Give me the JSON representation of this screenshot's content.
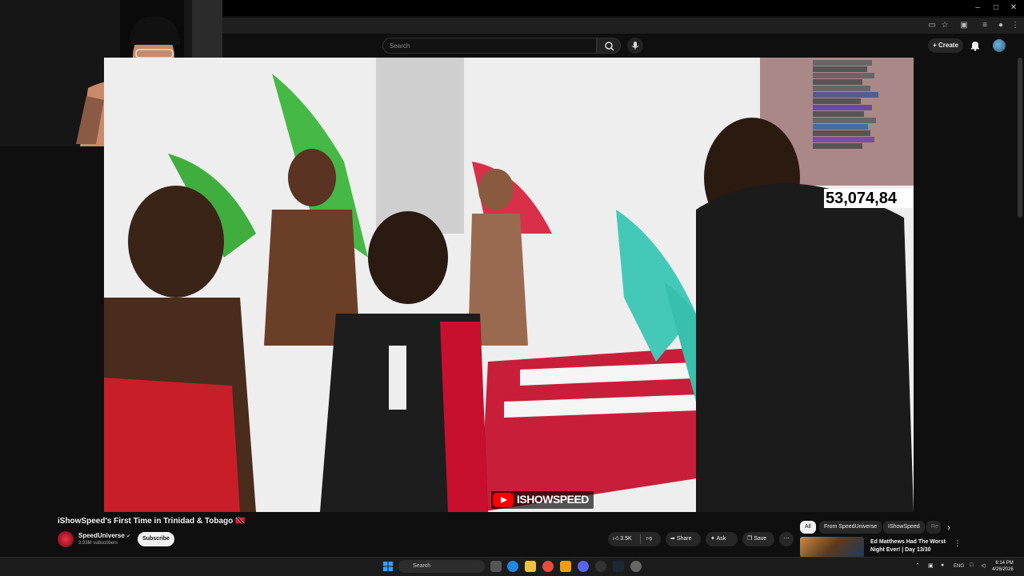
{
  "window": {
    "minimize": "–",
    "maximize": "□",
    "close": "✕"
  },
  "youtube": {
    "search_placeholder": "Search",
    "create_label": "Create",
    "icons": [
      "search-icon",
      "mic-icon",
      "bell-icon",
      "account-avatar"
    ]
  },
  "overlay": {
    "counter": "53,074,84",
    "watermark": "ISHOWSPEED"
  },
  "video": {
    "title": "iShowSpeed's First Time in Trinidad & Tobago 🇹🇹",
    "channel": "SpeedUniverse",
    "verified": "✔",
    "subscribers": "3.93M subscribers",
    "subscribe_label": "Subscribe",
    "likes": "3.5K",
    "share_label": "Share",
    "ask_label": "Ask",
    "save_label": "Save",
    "more_label": "⋯"
  },
  "recommendations": {
    "chips": [
      "All",
      "From SpeedUniverse",
      "IShowSpeed",
      "Re"
    ],
    "next_arrow": "›",
    "item_title": "Ed Matthews Had The Worst Night Ever! | Day 13/30",
    "item_menu": "⋮"
  },
  "taskbar": {
    "search_placeholder": "Search",
    "language": "ENG",
    "time": "6:14 PM",
    "date": "4/26/2026"
  },
  "colors": {
    "background": "#0f0f0f",
    "youtube_red": "#ff0000",
    "pill": "#272727"
  }
}
